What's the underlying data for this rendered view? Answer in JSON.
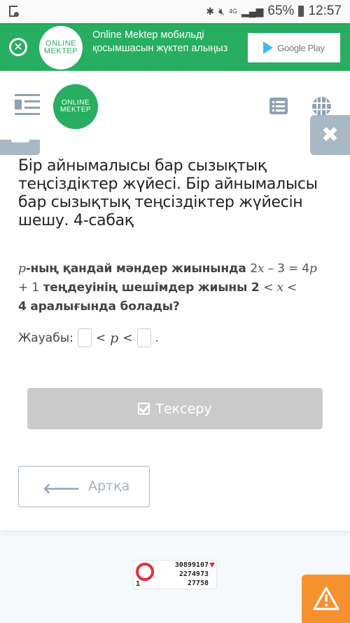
{
  "status_bar": {
    "network": "4G",
    "battery": "65%",
    "time": "12:57"
  },
  "banner": {
    "logo_line1": "ONLINE",
    "logo_line2": "MEKTEP",
    "message": "Online Mektep мобильді қосымшасын жүктеп алыңыз",
    "store_button": "Google Play",
    "close_icon": "close-circle-icon"
  },
  "header": {
    "logo_line1": "ONLINE",
    "logo_line2": "MEKTEP",
    "icons": [
      "menu-indent-icon",
      "list-icon",
      "globe-icon",
      "close-icon"
    ]
  },
  "lesson": {
    "title": "Бір айнымалысы бар сызықтық теңсіздіктер жүйесі. Бір айнымалысы бар сызықтық теңсіздіктер жүйесін шешу. 4-сабақ"
  },
  "question": {
    "var_p": "p",
    "text1": "-ның қандай мәндер жиынында ",
    "eq_a": "2",
    "eq_x": "x",
    "eq_b": " – 3 = 4",
    "eq_p": "p",
    "eq_c": " + 1",
    "text2": " теңдеуінің шешімдер жиыны 2 ",
    "lt1": "< ",
    "x2": "x",
    "lt2": " <",
    "text3": "4 аралығында болады?"
  },
  "answer": {
    "label": "Жауабы:",
    "lt": "<",
    "var": "p",
    "lt2": "<",
    "end": ".",
    "input1_value": "",
    "input2_value": ""
  },
  "buttons": {
    "check": "Тексеру",
    "back": "Артқа"
  },
  "counter_widget": {
    "value1": "30899107",
    "value2": "2274973",
    "value3": "27758",
    "value0": "1"
  },
  "colors": {
    "brand_green": "#27ae60",
    "icon_gray": "#8fa1b3",
    "warning_orange": "#f5922f",
    "check_button_disabled": "#cbcbcb"
  }
}
